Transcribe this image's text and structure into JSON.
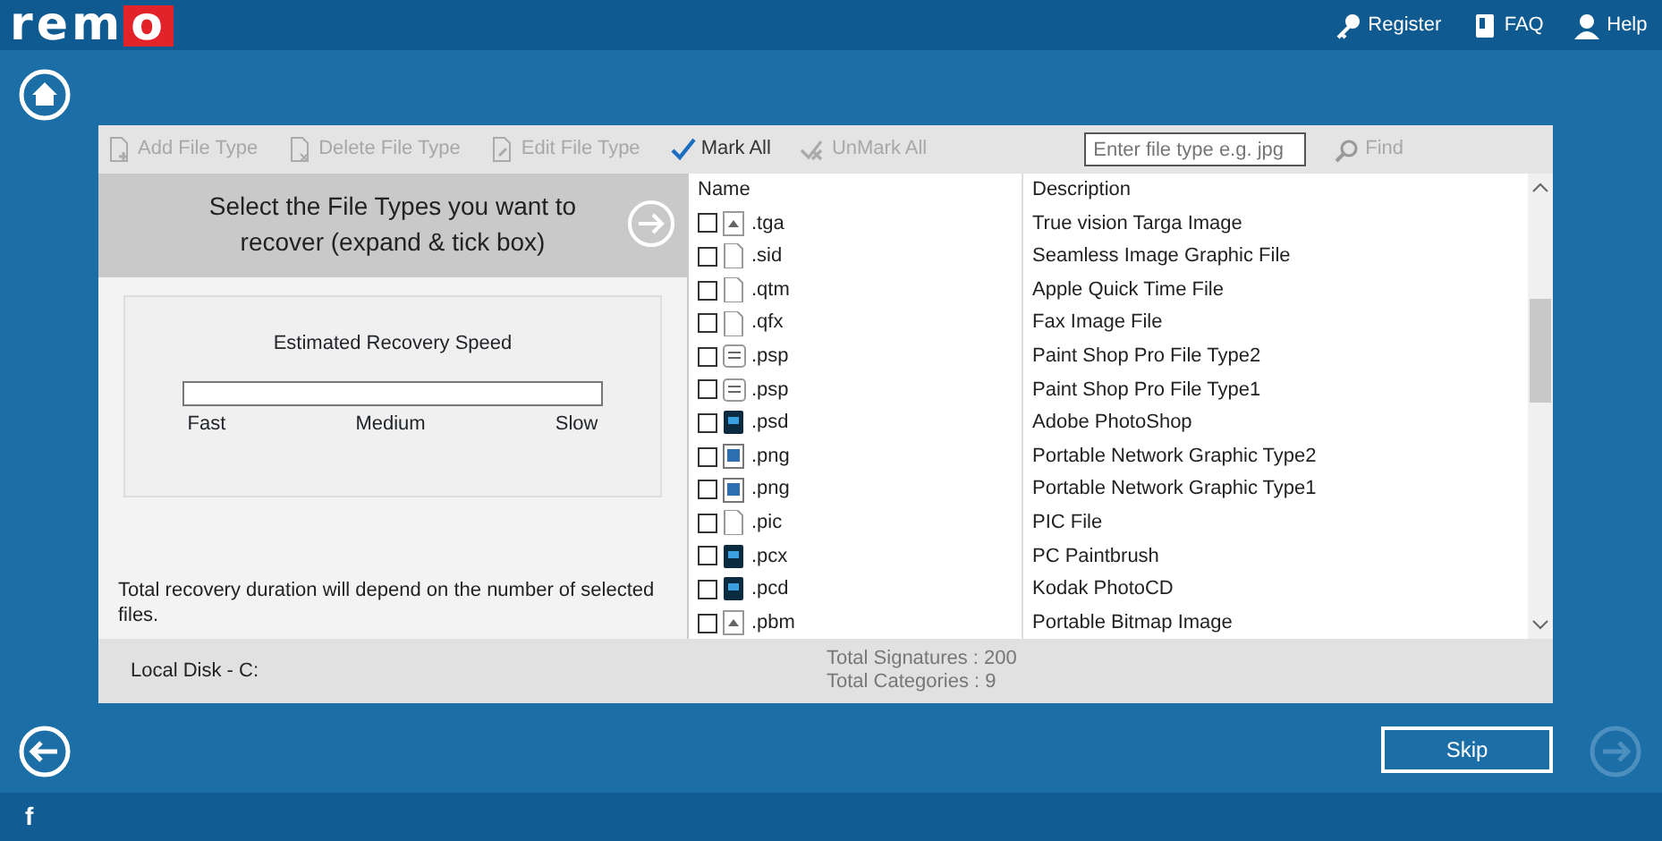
{
  "header": {
    "logo": "remo",
    "links": [
      {
        "kind": "key",
        "label": "Register"
      },
      {
        "kind": "book",
        "label": "FAQ"
      },
      {
        "kind": "person",
        "label": "Help"
      }
    ]
  },
  "toolbar": {
    "items": [
      {
        "kind": "add",
        "label": "Add File Type",
        "disabled": true
      },
      {
        "kind": "delete",
        "label": "Delete File Type",
        "disabled": true
      },
      {
        "kind": "edit",
        "label": "Edit File Type",
        "disabled": true
      },
      {
        "kind": "mark",
        "label": "Mark All",
        "disabled": false
      },
      {
        "kind": "unmark",
        "label": "UnMark All",
        "disabled": true
      }
    ],
    "search": {
      "placeholder": "Enter file type e.g. jpg"
    },
    "find": {
      "label": "Find",
      "disabled": true
    }
  },
  "left_panel": {
    "title": "Select the File Types you want to recover (expand & tick box)",
    "speed": {
      "title": "Estimated Recovery Speed",
      "labels": [
        "Fast",
        "Medium",
        "Slow"
      ]
    },
    "note": "Total recovery duration will depend on the number of selected files."
  },
  "table": {
    "columns": [
      "Name",
      "Description"
    ],
    "rows": [
      {
        "kind": "picture",
        "name": ".tga",
        "description": "True vision Targa Image",
        "checked": false
      },
      {
        "kind": "blank",
        "name": ".sid",
        "description": "Seamless Image Graphic File",
        "checked": false
      },
      {
        "kind": "blank",
        "name": ".qtm",
        "description": "Apple Quick Time File",
        "checked": false
      },
      {
        "kind": "blank",
        "name": ".qfx",
        "description": "Fax Image File",
        "checked": false
      },
      {
        "kind": "swap",
        "name": ".psp",
        "description": "Paint Shop Pro File Type2",
        "checked": false
      },
      {
        "kind": "swap",
        "name": ".psp",
        "description": "Paint Shop Pro File Type1",
        "checked": false
      },
      {
        "kind": "dark",
        "name": ".psd",
        "description": "Adobe PhotoShop",
        "checked": false
      },
      {
        "kind": "image",
        "name": ".png",
        "description": "Portable Network Graphic Type2",
        "checked": false
      },
      {
        "kind": "image",
        "name": ".png",
        "description": "Portable Network Graphic Type1",
        "checked": false
      },
      {
        "kind": "blank",
        "name": ".pic",
        "description": "PIC File",
        "checked": false
      },
      {
        "kind": "dark",
        "name": ".pcx",
        "description": "PC Paintbrush",
        "checked": false
      },
      {
        "kind": "dark",
        "name": ".pcd",
        "description": "Kodak PhotoCD",
        "checked": false
      },
      {
        "kind": "picture",
        "name": ".pbm",
        "description": "Portable Bitmap Image",
        "checked": false
      }
    ]
  },
  "status_bar": {
    "drive": "Local Disk - C:",
    "stats": [
      "Total Signatures : 200",
      "Total Categories : 9"
    ]
  },
  "footer": {
    "skip": "Skip",
    "social": "f"
  }
}
